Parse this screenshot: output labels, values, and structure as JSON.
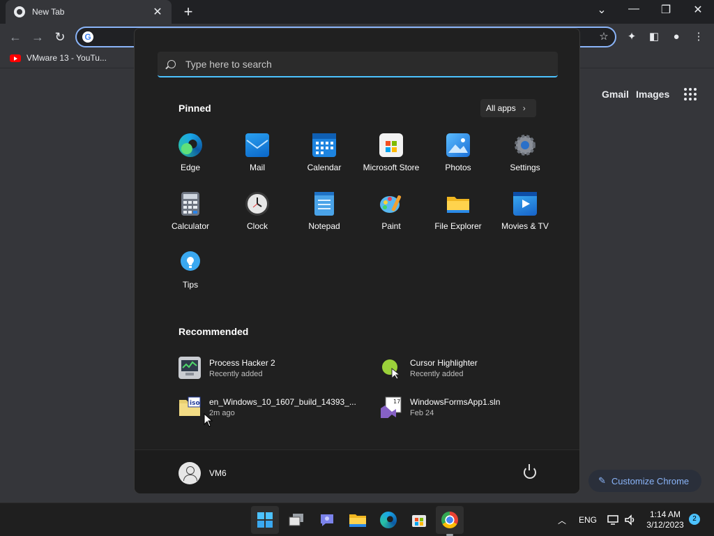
{
  "browser": {
    "tab_title": "New Tab",
    "tab_close": "✕",
    "new_tab": "+",
    "window_controls": [
      "⌄",
      "—",
      "❐",
      "✕"
    ],
    "omnibox_value": "",
    "bookmark": "VMware 13 - YouTu...",
    "ntp_links": [
      "Gmail",
      "Images"
    ],
    "customize_label": "Customize Chrome",
    "colors": {
      "accent": "#8ab4f8",
      "frame": "#202124",
      "page": "#35363a"
    }
  },
  "start_menu": {
    "search_placeholder": "Type here to search",
    "pinned_title": "Pinned",
    "all_apps_label": "All apps",
    "pinned": [
      {
        "label": "Edge",
        "icon": "edge-icon"
      },
      {
        "label": "Mail",
        "icon": "mail-icon"
      },
      {
        "label": "Calendar",
        "icon": "calendar-icon"
      },
      {
        "label": "Microsoft Store",
        "icon": "store-icon"
      },
      {
        "label": "Photos",
        "icon": "photos-icon"
      },
      {
        "label": "Settings",
        "icon": "settings-icon"
      },
      {
        "label": "Calculator",
        "icon": "calculator-icon"
      },
      {
        "label": "Clock",
        "icon": "clock-icon"
      },
      {
        "label": "Notepad",
        "icon": "notepad-icon"
      },
      {
        "label": "Paint",
        "icon": "paint-icon"
      },
      {
        "label": "File Explorer",
        "icon": "folder-icon"
      },
      {
        "label": "Movies & TV",
        "icon": "movies-icon"
      },
      {
        "label": "Tips",
        "icon": "lightbulb-icon"
      }
    ],
    "recommended_title": "Recommended",
    "recommended": [
      {
        "name": "Process Hacker 2",
        "sub": "Recently added",
        "icon": "process-hacker-icon"
      },
      {
        "name": "Cursor Highlighter",
        "sub": "Recently added",
        "icon": "cursor-highlighter-icon"
      },
      {
        "name": "en_Windows_10_1607_build_14393_...",
        "sub": "2m ago",
        "icon": "iso-file-icon"
      },
      {
        "name": "WindowsFormsApp1.sln",
        "sub": "Feb 24",
        "icon": "visual-studio-icon"
      }
    ],
    "user_name": "VM6"
  },
  "taskbar": {
    "apps": [
      "start-icon",
      "task-view-icon",
      "chat-icon",
      "file-explorer-icon",
      "edge-icon",
      "store-icon",
      "chrome-icon"
    ],
    "language": "ENG",
    "time": "1:14 AM",
    "date": "3/12/2023",
    "notifications": "2",
    "colors": {
      "accent": "#4cc2ff"
    }
  }
}
